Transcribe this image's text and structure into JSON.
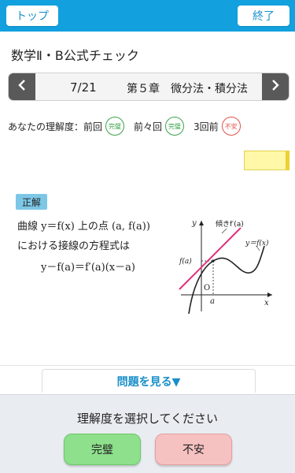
{
  "header": {
    "top_label": "トップ",
    "end_label": "終了"
  },
  "book_title": "数学Ⅱ・B公式チェック",
  "chapter_nav": {
    "prev_icon": "chevron-left-icon",
    "next_icon": "chevron-right-icon",
    "page": "7/21",
    "chapter": "第５章　微分法・積分法"
  },
  "history": {
    "label": "あなたの理解度：",
    "items": [
      {
        "label": "前回",
        "stamp": "完璧",
        "status": "ok"
      },
      {
        "label": "前々回",
        "stamp": "完璧",
        "status": "ok"
      },
      {
        "label": "3回前",
        "stamp": "不安",
        "status": "ng"
      }
    ]
  },
  "answer": {
    "tag": "正解",
    "line1": "曲線 y＝f(x) 上の点 (a, f(a))",
    "line2": "における接線の方程式は",
    "line3": "y－f(a)＝f′(a)(x－a)"
  },
  "graph": {
    "y_axis": "y",
    "x_axis": "x",
    "origin": "O",
    "tick_a": "a",
    "tick_fa": "f(a)",
    "slope_label": "傾きf′(a)",
    "curve_label": "y＝f(x)"
  },
  "show_question": "問題を見る▼",
  "rating": {
    "prompt": "理解度を選択してください",
    "ok_label": "完璧",
    "ng_label": "不安"
  },
  "colors": {
    "header": "#12a0df",
    "ok": "#8ee08c",
    "ng": "#f6c1c1",
    "tangent": "#e0307a"
  }
}
